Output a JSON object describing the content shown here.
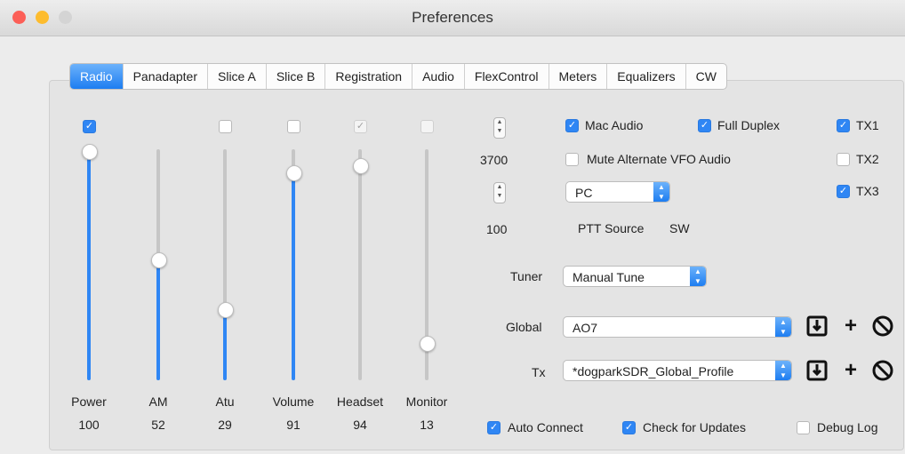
{
  "window": {
    "title": "Preferences"
  },
  "tabs": [
    "Radio",
    "Panadapter",
    "Slice A",
    "Slice B",
    "Registration",
    "Audio",
    "FlexControl",
    "Meters",
    "Equalizers",
    "CW"
  ],
  "sliders": [
    {
      "label": "Power",
      "value": "100",
      "checked": true
    },
    {
      "label": "AM",
      "value": "52"
    },
    {
      "label": "Atu",
      "value": "29",
      "checked": false
    },
    {
      "label": "Volume",
      "value": "91",
      "checked": false
    },
    {
      "label": "Headset",
      "value": "94",
      "checked": true,
      "disabled": true
    },
    {
      "label": "Monitor",
      "value": "13",
      "checked": false,
      "disabled": true
    }
  ],
  "steppers": {
    "rf_value": "3700",
    "tune_value": "100"
  },
  "options": {
    "mac_audio": "Mac Audio",
    "full_duplex": "Full Duplex",
    "mute_alt": "Mute Alternate VFO Audio",
    "tx1": "TX1",
    "tx2": "TX2",
    "tx3": "TX3"
  },
  "ptt": {
    "selected": "PC",
    "label": "PTT Source",
    "source": "SW"
  },
  "tuner": {
    "label": "Tuner",
    "selected": "Manual Tune"
  },
  "profiles": {
    "global_label": "Global",
    "global_value": "AO7",
    "tx_label": "Tx",
    "tx_value": "*dogparkSDR_Global_Profile"
  },
  "footer": {
    "auto_connect": "Auto Connect",
    "check_updates": "Check for Updates",
    "debug_log": "Debug Log"
  },
  "icons": {
    "save": "save-icon",
    "add": "+",
    "delete": "⃠"
  },
  "colors": {
    "accent": "#2f86f4"
  }
}
